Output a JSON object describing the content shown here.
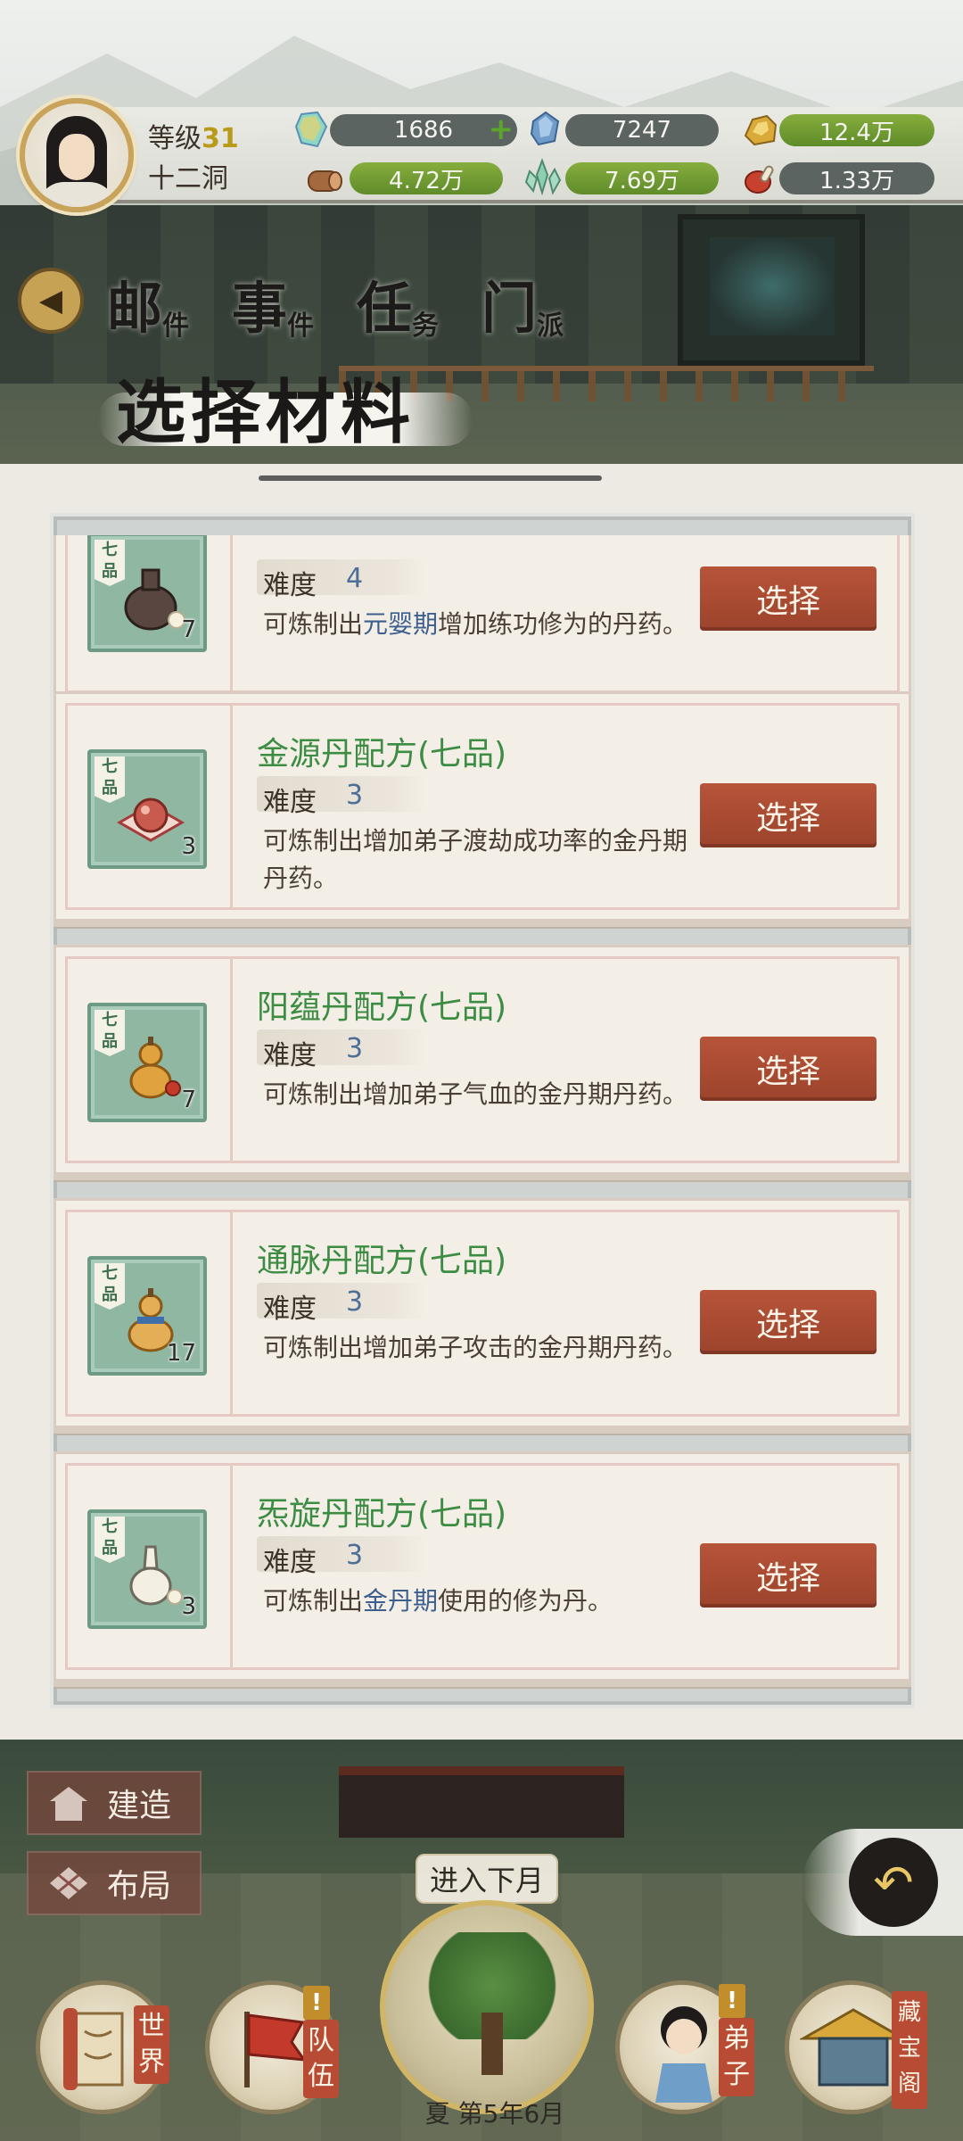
{
  "header": {
    "level_label": "等级",
    "level_value": "31",
    "sect_name": "十二洞"
  },
  "resources": {
    "spirit_stone": "1686",
    "blue_crystal": "7247",
    "gold_ore": "12.4万",
    "wood": "4.72万",
    "herb_crystal": "7.69万",
    "meat": "1.33万"
  },
  "tabs": [
    {
      "big": "邮",
      "small": "件"
    },
    {
      "big": "事",
      "small": "件"
    },
    {
      "big": "任",
      "small": "务"
    },
    {
      "big": "门",
      "small": "派"
    }
  ],
  "title": "选择材料",
  "recipes": [
    {
      "name": "",
      "difficulty_label": "难度",
      "difficulty": "4",
      "desc_prefix": "可炼制出",
      "desc_highlight": "元婴期",
      "desc_suffix": "增加练功修为的丹药。",
      "count": "7",
      "grade": "七品",
      "icon": "dark-vase-icon",
      "button": "选择"
    },
    {
      "name": "金源丹配方(七品)",
      "difficulty_label": "难度",
      "difficulty": "3",
      "desc_prefix": "可炼制出增加弟子渡劫成功率的金丹期丹药。",
      "desc_highlight": "",
      "desc_suffix": "",
      "count": "3",
      "grade": "七品",
      "icon": "red-pill-icon",
      "button": "选择"
    },
    {
      "name": "阳蕴丹配方(七品)",
      "difficulty_label": "难度",
      "difficulty": "3",
      "desc_prefix": "可炼制出增加弟子气血的金丹期丹药。",
      "desc_highlight": "",
      "desc_suffix": "",
      "count": "7",
      "grade": "七品",
      "icon": "gourd-icon",
      "button": "选择"
    },
    {
      "name": "通脉丹配方(七品)",
      "difficulty_label": "难度",
      "difficulty": "3",
      "desc_prefix": "可炼制出增加弟子攻击的金丹期丹药。",
      "desc_highlight": "",
      "desc_suffix": "",
      "count": "17",
      "grade": "七品",
      "icon": "gourd-icon",
      "button": "选择"
    },
    {
      "name": "炁旋丹配方(七品)",
      "difficulty_label": "难度",
      "difficulty": "3",
      "desc_prefix": "可炼制出",
      "desc_highlight": "金丹期",
      "desc_suffix": "使用的修为丹。",
      "count": "3",
      "grade": "七品",
      "icon": "white-vase-icon",
      "button": "选择"
    }
  ],
  "side_buttons": {
    "build": "建造",
    "layout": "布局"
  },
  "next_month": "进入下月",
  "season": "夏",
  "date": "第5年6月",
  "nav": {
    "world": "世界",
    "team": "队伍",
    "disciples": "弟子",
    "treasury": "藏宝阁"
  },
  "colors": {
    "select_button": "#b65439",
    "recipe_name": "#3c8c43",
    "highlight": "#3d5f8f",
    "resource_green": "#86ad3d"
  }
}
